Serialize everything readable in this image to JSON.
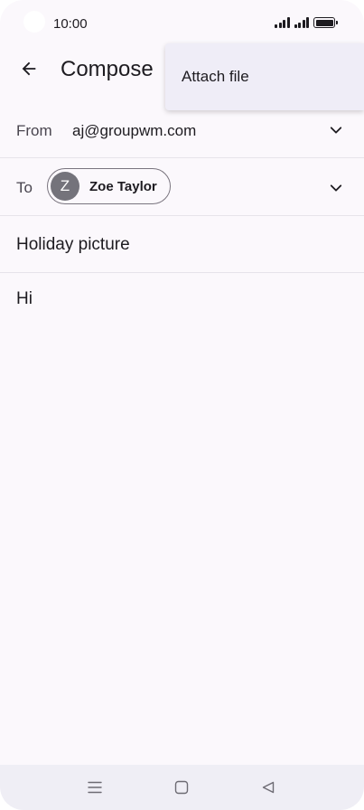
{
  "status_bar": {
    "time": "10:00"
  },
  "header": {
    "title": "Compose"
  },
  "menu": {
    "items": [
      {
        "label": "Attach file"
      }
    ]
  },
  "from": {
    "label": "From",
    "value": "aj@groupwm.com"
  },
  "to": {
    "label": "To",
    "recipient": {
      "initial": "Z",
      "name": "Zoe Taylor"
    }
  },
  "subject": {
    "value": "Holiday picture"
  },
  "body": {
    "value": "Hi"
  },
  "colors": {
    "background": "#fbf8fc",
    "menu": "#efedf7",
    "avatar": "#74737b",
    "nav_bar": "#efeef5"
  },
  "icons": {
    "back": "arrow-left-icon",
    "expand": "chevron-down-icon",
    "nav": [
      "menu-icon",
      "home-icon",
      "back-triangle-icon"
    ]
  }
}
